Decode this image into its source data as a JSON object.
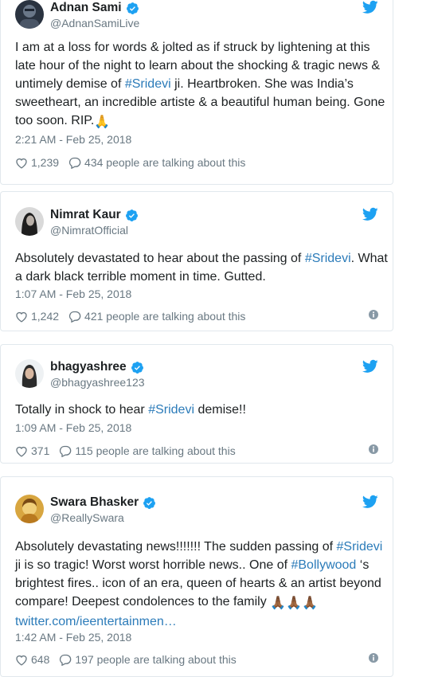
{
  "brand": {
    "twitter_blue": "#1da1f2",
    "link_blue": "#2b7bb9",
    "gray": "#697882"
  },
  "tweets": [
    {
      "name": "Adnan Sami",
      "handle": "@AdnanSamiLive",
      "text_parts": [
        "I am at a loss for words & jolted as if struck by lightening at this late hour of the night to learn about the shocking & tragic news & untimely demise of ",
        "#Sridevi",
        " ji. Heartbroken. She was India’s sweetheart, an incredible artiste & a beautiful human being. Gone too soon. RIP.",
        "🙏"
      ],
      "time": "2:21 AM - Feb 25, 2018",
      "likes": "1,239",
      "talking": "434 people are talking about this",
      "icons": [
        "avatar",
        "verified-icon",
        "twitter-bird-icon",
        "heart-icon",
        "comment-icon"
      ]
    },
    {
      "name": "Nimrat Kaur",
      "handle": "@NimratOfficial",
      "text_parts": [
        "Absolutely devastated to hear about the passing of ",
        "#Sridevi",
        ". What a dark black terrible moment in time. Gutted."
      ],
      "time": "1:07 AM - Feb 25, 2018",
      "likes": "1,242",
      "talking": "421 people are talking about this",
      "icons": [
        "avatar",
        "verified-icon",
        "twitter-bird-icon",
        "heart-icon",
        "comment-icon",
        "info-icon"
      ]
    },
    {
      "name": "bhagyashree",
      "handle": "@bhagyashree123",
      "text_parts": [
        "Totally in shock to hear ",
        "#Sridevi",
        " demise!!"
      ],
      "time": "1:09 AM - Feb 25, 2018",
      "likes": "371",
      "talking": "115 people are talking about this",
      "icons": [
        "avatar",
        "verified-icon",
        "twitter-bird-icon",
        "heart-icon",
        "comment-icon",
        "info-icon"
      ]
    },
    {
      "name": "Swara Bhasker",
      "handle": "@ReallySwara",
      "text_parts": [
        "Absolutely devastating news!!!!!!! The sudden passing of ",
        "#Sridevi",
        " ji is so tragic! Worst worst horrible news.. One of ",
        "#Bollywood",
        " ‘s brightest fires.. icon of an era, queen of hearts & an artist beyond compare! Deepest condolences to the family ",
        "🙏🏾🙏🏾🙏🏾",
        " ",
        "twitter.com/ieentertainmen…"
      ],
      "time": "1:42 AM - Feb 25, 2018",
      "likes": "648",
      "talking": "197 people are talking about this",
      "icons": [
        "avatar",
        "verified-icon",
        "twitter-bird-icon",
        "heart-icon",
        "comment-icon",
        "info-icon"
      ]
    }
  ]
}
